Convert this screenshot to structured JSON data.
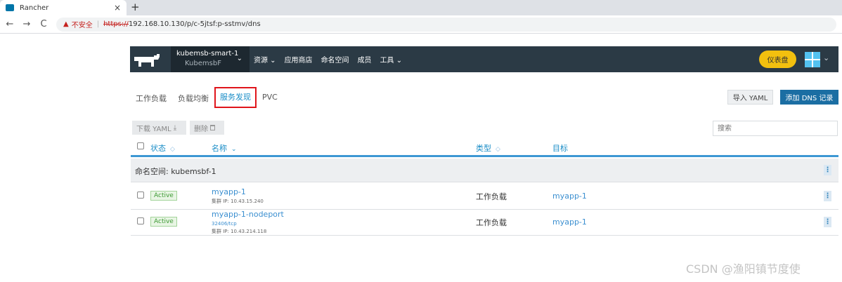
{
  "browser": {
    "tab_title": "Rancher",
    "tab_close": "×",
    "new_tab": "+",
    "back": "←",
    "forward": "→",
    "reload": "C",
    "warning_icon": "▲",
    "insecure_label": "不安全",
    "separator": "|",
    "url_scheme": "https://",
    "url_rest": "192.168.10.130/p/c-5jtsf:p-sstmv/dns"
  },
  "header": {
    "cluster_name": "kubemsb-smart-1",
    "project_name": "KubemsbF",
    "cluster_chevron": "⌄",
    "nav": [
      {
        "label": "资源",
        "dropdown": true
      },
      {
        "label": "应用商店",
        "dropdown": false
      },
      {
        "label": "命名空间",
        "dropdown": false
      },
      {
        "label": "成员",
        "dropdown": false
      },
      {
        "label": "工具",
        "dropdown": true
      }
    ],
    "dashboard_label": "仪表盘",
    "avatar_chevron": "⌄"
  },
  "subtabs": [
    {
      "label": "工作负载",
      "active": false
    },
    {
      "label": "负载均衡",
      "active": false
    },
    {
      "label": "服务发现",
      "active": true
    },
    {
      "label": "PVC",
      "active": false
    }
  ],
  "actions": {
    "import_yaml": "导入 YAML",
    "add_dns": "添加 DNS 记录",
    "download_yaml": "下载 YAML",
    "download_icon": "⤓",
    "delete": "删除",
    "delete_icon": "🗑",
    "search_placeholder": "搜索"
  },
  "table": {
    "columns": {
      "state": "状态",
      "name": "名称",
      "type": "类型",
      "target": "目标",
      "sort_up": "◇",
      "sort_down": "⌄"
    },
    "namespace_label": "命名空间: kubemsbf-1",
    "kebab": "⋮",
    "rows": [
      {
        "status": "Active",
        "name": "myapp-1",
        "port": "",
        "cluster_ip": "集群 IP: 10.43.15.240",
        "type": "工作负载",
        "target": "myapp-1"
      },
      {
        "status": "Active",
        "name": "myapp-1-nodeport",
        "port": "32406/tcp",
        "cluster_ip": "集群 IP: 10.43.214.118",
        "type": "工作负载",
        "target": "myapp-1"
      }
    ]
  },
  "watermark": "CSDN @渔阳镇节度使",
  "colors": {
    "header_bg": "#2b3a45",
    "accent_blue": "#1a8dc7",
    "add_button": "#1b6ea3",
    "dashboard_yellow": "#f2c00f",
    "active_green": "#3d9a34",
    "highlight_red": "#e0151b"
  }
}
